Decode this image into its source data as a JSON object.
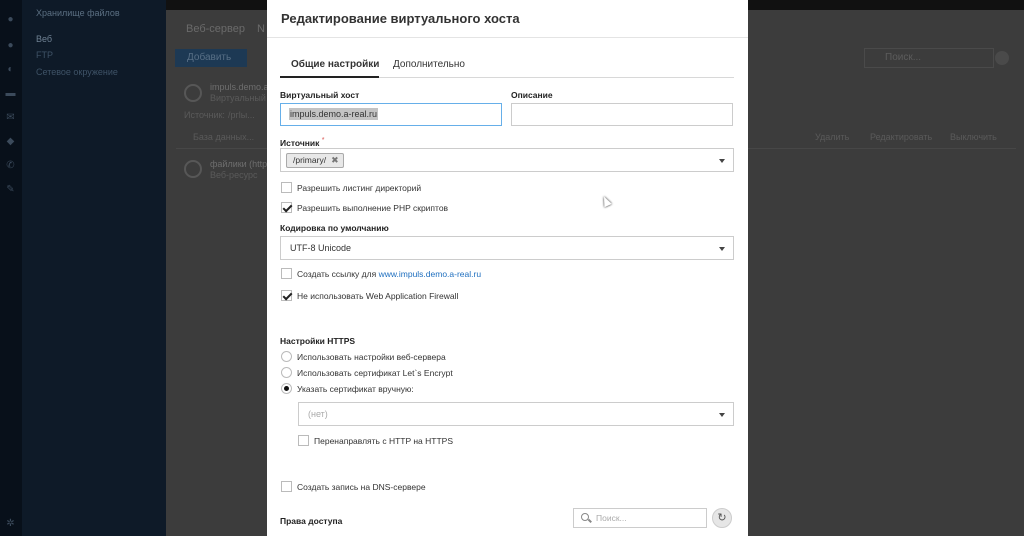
{
  "sidebar": {
    "header": "Хранилище файлов",
    "items": [
      "Веб",
      "FTP",
      "Сетевое окружение"
    ]
  },
  "background": {
    "tabs": [
      "Веб-сервер",
      "N"
    ],
    "add_button": "Добавить",
    "search_placeholder": "Поиск...",
    "row1_title": "impuls.demo.a",
    "row1_sub": "Виртуальный х",
    "row1_source": "Источник:",
    "row1_source_val": "/ргlы...",
    "row1_db": "База данных...",
    "actions": [
      "Удалить",
      "Редактировать",
      "Выключить"
    ],
    "row2_title": "файлики (http",
    "row2_sub": "Веб-ресурс"
  },
  "modal": {
    "title": "Редактирование виртуального хоста",
    "tabs": [
      "Общие настройки",
      "Дополнительно"
    ],
    "virtual_host_label": "Виртуальный хост",
    "virtual_host_value": "impuls.demo.a-real.ru",
    "description_label": "Описание",
    "description_value": "",
    "source_label": "Источник",
    "source_required": "*",
    "source_tag": "/primary/",
    "allow_listing": "Разрешить листинг директорий",
    "allow_php": "Разрешить выполнение PHP скриптов",
    "encoding_label": "Кодировка по умолчанию",
    "encoding_value": "UTF-8 Unicode",
    "create_link_prefix": "Создать ссылку для",
    "create_link_url": "www.impuls.demo.a-real.ru",
    "no_waf": "Не использовать Web Application Firewall",
    "https_label": "Настройки HTTPS",
    "https_options": [
      "Использовать настройки веб-сервера",
      "Использовать сертификат Let`s Encrypt",
      "Указать сертификат вручную:"
    ],
    "https_selected": 2,
    "cert_value": "(нет)",
    "redirect_https": "Перенаправлять с HTTP на HTTPS",
    "dns_record": "Создать запись на DNS-сервере",
    "access_label": "Права доступа",
    "search_placeholder": "Поиск..."
  },
  "state": {
    "allow_listing": false,
    "allow_php": true,
    "create_link": false,
    "no_waf": true,
    "redirect_https": false,
    "dns_record": false
  }
}
